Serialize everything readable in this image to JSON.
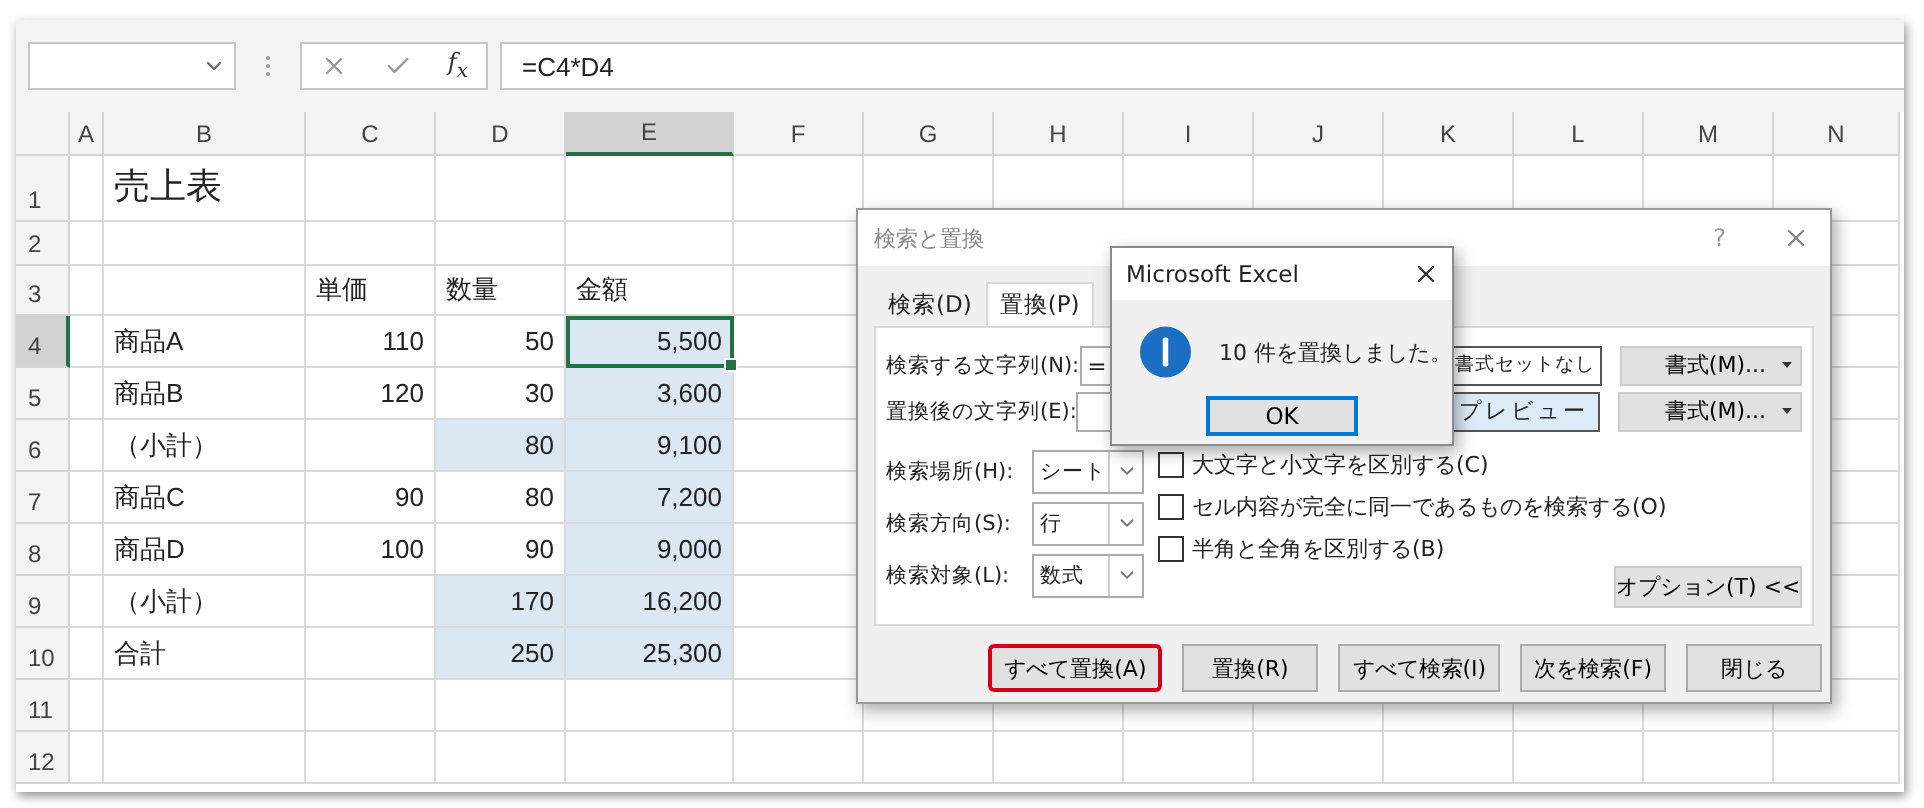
{
  "formula_bar": {
    "function_label": "f$_{x}$",
    "formula": "=C4*D4"
  },
  "columns": [
    {
      "label": "A",
      "selected": false
    },
    {
      "label": "B",
      "selected": false
    },
    {
      "label": "C",
      "selected": false
    },
    {
      "label": "D",
      "selected": false
    },
    {
      "label": "E",
      "selected": true
    },
    {
      "label": "F",
      "selected": false
    },
    {
      "label": "G",
      "selected": false
    },
    {
      "label": "H",
      "selected": false
    },
    {
      "label": "I",
      "selected": false
    },
    {
      "label": "J",
      "selected": false
    },
    {
      "label": "K",
      "selected": false
    },
    {
      "label": "L",
      "selected": false
    },
    {
      "label": "M",
      "selected": false
    },
    {
      "label": "N",
      "selected": false
    }
  ],
  "rows": [
    {
      "label": "1",
      "selected": false,
      "cells": [
        {
          "selected": false,
          "active": false
        },
        {
          "text": "売上表",
          "kind": "title",
          "selected": false,
          "active": false
        },
        {
          "selected": false,
          "active": false
        },
        {
          "selected": false,
          "active": false
        },
        {
          "selected": false,
          "active": false
        },
        {
          "selected": false,
          "active": false
        }
      ]
    },
    {
      "label": "2",
      "selected": false,
      "cells": [
        {
          "selected": false,
          "active": false
        },
        {
          "selected": false,
          "active": false
        },
        {
          "selected": false,
          "active": false
        },
        {
          "selected": false,
          "active": false
        },
        {
          "selected": false,
          "active": false
        },
        {
          "selected": false,
          "active": false
        }
      ]
    },
    {
      "label": "3",
      "selected": false,
      "cells": [
        {
          "selected": false,
          "active": false
        },
        {
          "selected": false,
          "active": false
        },
        {
          "text": "単価",
          "kind": "text",
          "selected": false,
          "active": false
        },
        {
          "text": "数量",
          "kind": "text",
          "selected": false,
          "active": false
        },
        {
          "text": "金額",
          "kind": "text",
          "selected": false,
          "active": false
        },
        {
          "selected": false,
          "active": false
        }
      ]
    },
    {
      "label": "4",
      "selected": true,
      "cells": [
        {
          "selected": false,
          "active": false
        },
        {
          "text": "商品A",
          "kind": "text",
          "selected": false,
          "active": false
        },
        {
          "text": "110",
          "kind": "number",
          "selected": false,
          "active": false
        },
        {
          "text": "50",
          "kind": "number",
          "selected": false,
          "active": false
        },
        {
          "text": "5,500",
          "kind": "number",
          "selected": true,
          "active": true
        },
        {
          "selected": false,
          "active": false
        }
      ]
    },
    {
      "label": "5",
      "selected": false,
      "cells": [
        {
          "selected": false,
          "active": false
        },
        {
          "text": "商品B",
          "kind": "text",
          "selected": false,
          "active": false
        },
        {
          "text": "120",
          "kind": "number",
          "selected": false,
          "active": false
        },
        {
          "text": "30",
          "kind": "number",
          "selected": false,
          "active": false
        },
        {
          "text": "3,600",
          "kind": "number",
          "selected": true,
          "active": false
        },
        {
          "selected": false,
          "active": false
        }
      ]
    },
    {
      "label": "6",
      "selected": false,
      "cells": [
        {
          "selected": false,
          "active": false
        },
        {
          "text": "（小計）",
          "kind": "text",
          "selected": false,
          "active": false
        },
        {
          "selected": false,
          "active": false
        },
        {
          "text": "80",
          "kind": "number",
          "selected": true,
          "active": false
        },
        {
          "text": "9,100",
          "kind": "number",
          "selected": true,
          "active": false
        },
        {
          "selected": false,
          "active": false
        }
      ]
    },
    {
      "label": "7",
      "selected": false,
      "cells": [
        {
          "selected": false,
          "active": false
        },
        {
          "text": "商品C",
          "kind": "text",
          "selected": false,
          "active": false
        },
        {
          "text": "90",
          "kind": "number",
          "selected": false,
          "active": false
        },
        {
          "text": "80",
          "kind": "number",
          "selected": false,
          "active": false
        },
        {
          "text": "7,200",
          "kind": "number",
          "selected": true,
          "active": false
        },
        {
          "selected": false,
          "active": false
        }
      ]
    },
    {
      "label": "8",
      "selected": false,
      "cells": [
        {
          "selected": false,
          "active": false
        },
        {
          "text": "商品D",
          "kind": "text",
          "selected": false,
          "active": false
        },
        {
          "text": "100",
          "kind": "number",
          "selected": false,
          "active": false
        },
        {
          "text": "90",
          "kind": "number",
          "selected": false,
          "active": false
        },
        {
          "text": "9,000",
          "kind": "number",
          "selected": true,
          "active": false
        },
        {
          "selected": false,
          "active": false
        }
      ]
    },
    {
      "label": "9",
      "selected": false,
      "cells": [
        {
          "selected": false,
          "active": false
        },
        {
          "text": "（小計）",
          "kind": "text",
          "selected": false,
          "active": false
        },
        {
          "selected": false,
          "active": false
        },
        {
          "text": "170",
          "kind": "number",
          "selected": true,
          "active": false
        },
        {
          "text": "16,200",
          "kind": "number",
          "selected": true,
          "active": false
        },
        {
          "selected": false,
          "active": false
        }
      ]
    },
    {
      "label": "10",
      "selected": false,
      "cells": [
        {
          "selected": false,
          "active": false
        },
        {
          "text": "合計",
          "kind": "text",
          "selected": false,
          "active": false
        },
        {
          "selected": false,
          "active": false
        },
        {
          "text": "250",
          "kind": "number",
          "selected": true,
          "active": false
        },
        {
          "text": "25,300",
          "kind": "number",
          "selected": true,
          "active": false
        },
        {
          "selected": false,
          "active": false
        }
      ]
    },
    {
      "label": "11",
      "selected": false,
      "cells": [
        {
          "selected": false,
          "active": false
        },
        {
          "selected": false,
          "active": false
        },
        {
          "selected": false,
          "active": false
        },
        {
          "selected": false,
          "active": false
        },
        {
          "selected": false,
          "active": false
        },
        {
          "selected": false,
          "active": false
        }
      ]
    },
    {
      "label": "12",
      "selected": false,
      "cells": [
        {
          "selected": false,
          "active": false
        },
        {
          "selected": false,
          "active": false
        },
        {
          "selected": false,
          "active": false
        },
        {
          "selected": false,
          "active": false
        },
        {
          "selected": false,
          "active": false
        },
        {
          "selected": false,
          "active": false
        }
      ]
    }
  ],
  "replace_dialog": {
    "title": "検索と置換",
    "help": "?",
    "tabs": [
      {
        "label": "検索(D)",
        "selected": false
      },
      {
        "label": "置換(P)",
        "selected": true
      }
    ],
    "fields": [
      {
        "label": "検索する文字列(N):",
        "value": "=",
        "preview": "書式セットなし",
        "preview_highlighted": false,
        "format_button": "書式(M)..."
      },
      {
        "label": "置換後の文字列(E):",
        "preview": "プレビュー",
        "preview_highlighted": true,
        "format_button": "書式(M)..."
      }
    ],
    "dropdowns": [
      {
        "label": "検索場所(H):",
        "value": "シート"
      },
      {
        "label": "検索方向(S):",
        "value": "行"
      },
      {
        "label": "検索対象(L):",
        "value": "数式"
      }
    ],
    "checkboxes": [
      {
        "label": "大文字と小文字を区別する(C)",
        "checked": false
      },
      {
        "label": "セル内容が完全に同一であるものを検索する(O)",
        "checked": false
      },
      {
        "label": "半角と全角を区別する(B)",
        "checked": false
      }
    ],
    "options_button": "オプション(T) <<",
    "buttons": [
      {
        "label": "すべて置換(A)",
        "highlighted": true
      },
      {
        "label": "置換(R)",
        "highlighted": false
      },
      {
        "label": "すべて検索(I)",
        "highlighted": false
      },
      {
        "label": "次を検索(F)",
        "highlighted": false
      },
      {
        "label": "閉じる",
        "highlighted": false
      }
    ]
  },
  "message_box": {
    "title": "Microsoft Excel",
    "message": "10 件を置換しました。",
    "ok": "OK"
  }
}
